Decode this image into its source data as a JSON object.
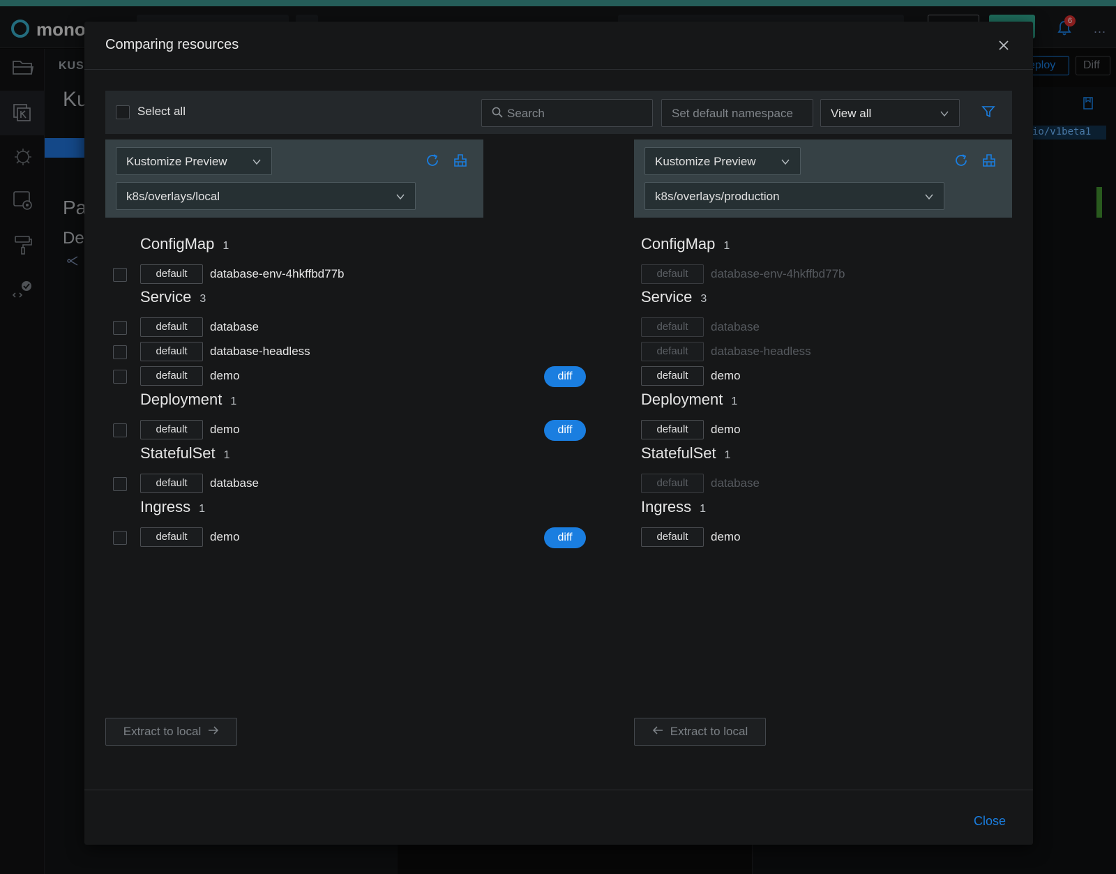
{
  "app": {
    "logo_text": "mono",
    "notification_count": "6",
    "more": "...",
    "bg_section": "KUS",
    "bg_title": "Ku",
    "bg_pa": "Pa",
    "bg_de": "De",
    "deploy_label": "eploy",
    "diff_label": "Diff",
    "code_snippet": "io/v1beta1"
  },
  "modal": {
    "title": "Comparing resources",
    "close_label": "Close"
  },
  "toolbar": {
    "select_all": "Select all",
    "search_placeholder": "Search",
    "set_namespace": "Set default namespace",
    "view_filter": "View all"
  },
  "left": {
    "source_type": "Kustomize Preview",
    "path": "k8s/overlays/local",
    "extract_label": "Extract to local"
  },
  "right": {
    "source_type": "Kustomize Preview",
    "path": "k8s/overlays/production",
    "extract_label": "Extract to local"
  },
  "diff_label": "diff",
  "groups": [
    {
      "kind": "ConfigMap",
      "count": "1",
      "rows": [
        {
          "namespace": "default",
          "name": "database-env-4hkffbd77b",
          "right_present": false,
          "diff": false
        }
      ]
    },
    {
      "kind": "Service",
      "count": "3",
      "rows": [
        {
          "namespace": "default",
          "name": "database",
          "right_present": false,
          "diff": false
        },
        {
          "namespace": "default",
          "name": "database-headless",
          "right_present": false,
          "diff": false
        },
        {
          "namespace": "default",
          "name": "demo",
          "right_present": true,
          "diff": true
        }
      ]
    },
    {
      "kind": "Deployment",
      "count": "1",
      "rows": [
        {
          "namespace": "default",
          "name": "demo",
          "right_present": true,
          "diff": true
        }
      ]
    },
    {
      "kind": "StatefulSet",
      "count": "1",
      "rows": [
        {
          "namespace": "default",
          "name": "database",
          "right_present": false,
          "diff": false
        }
      ]
    },
    {
      "kind": "Ingress",
      "count": "1",
      "rows": [
        {
          "namespace": "default",
          "name": "demo",
          "right_present": true,
          "diff": true
        }
      ]
    }
  ]
}
